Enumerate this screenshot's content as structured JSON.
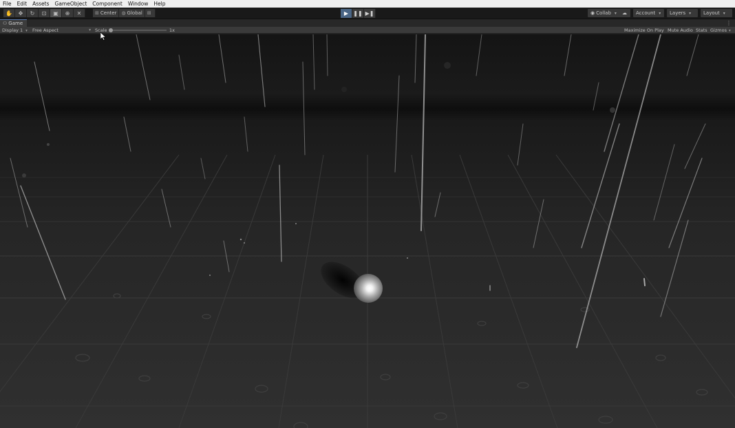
{
  "menubar": {
    "items": [
      "File",
      "Edit",
      "Assets",
      "GameObject",
      "Component",
      "Window",
      "Help"
    ]
  },
  "toolbar": {
    "tools": [
      {
        "icon": "hand-icon",
        "glyph": "✋"
      },
      {
        "icon": "move-icon",
        "glyph": "✥"
      },
      {
        "icon": "rotate-icon",
        "glyph": "↻"
      },
      {
        "icon": "scale-icon",
        "glyph": "⊡"
      },
      {
        "icon": "rect-tool-icon",
        "glyph": "▣"
      },
      {
        "icon": "transform-icon",
        "glyph": "⊕"
      },
      {
        "icon": "custom-tool-icon",
        "glyph": "✕"
      }
    ],
    "pivot_center": "Center",
    "pivot_global": "Global",
    "collab": "Collab",
    "account": "Account",
    "layers": "Layers",
    "layout": "Layout"
  },
  "game_tab": {
    "label": "Game"
  },
  "gamebar": {
    "display": "Display 1",
    "aspect": "Free Aspect",
    "scale_label": "Scale",
    "scale_value": "1x",
    "maximize": "Maximize On Play",
    "mute": "Mute Audio",
    "stats": "Stats",
    "gizmos": "Gizmos"
  },
  "colors": {
    "menubar_bg": "#efefef",
    "toolbar_bg": "#191919",
    "play_active": "#4a6585",
    "panel_bg": "#3a3a3a"
  }
}
